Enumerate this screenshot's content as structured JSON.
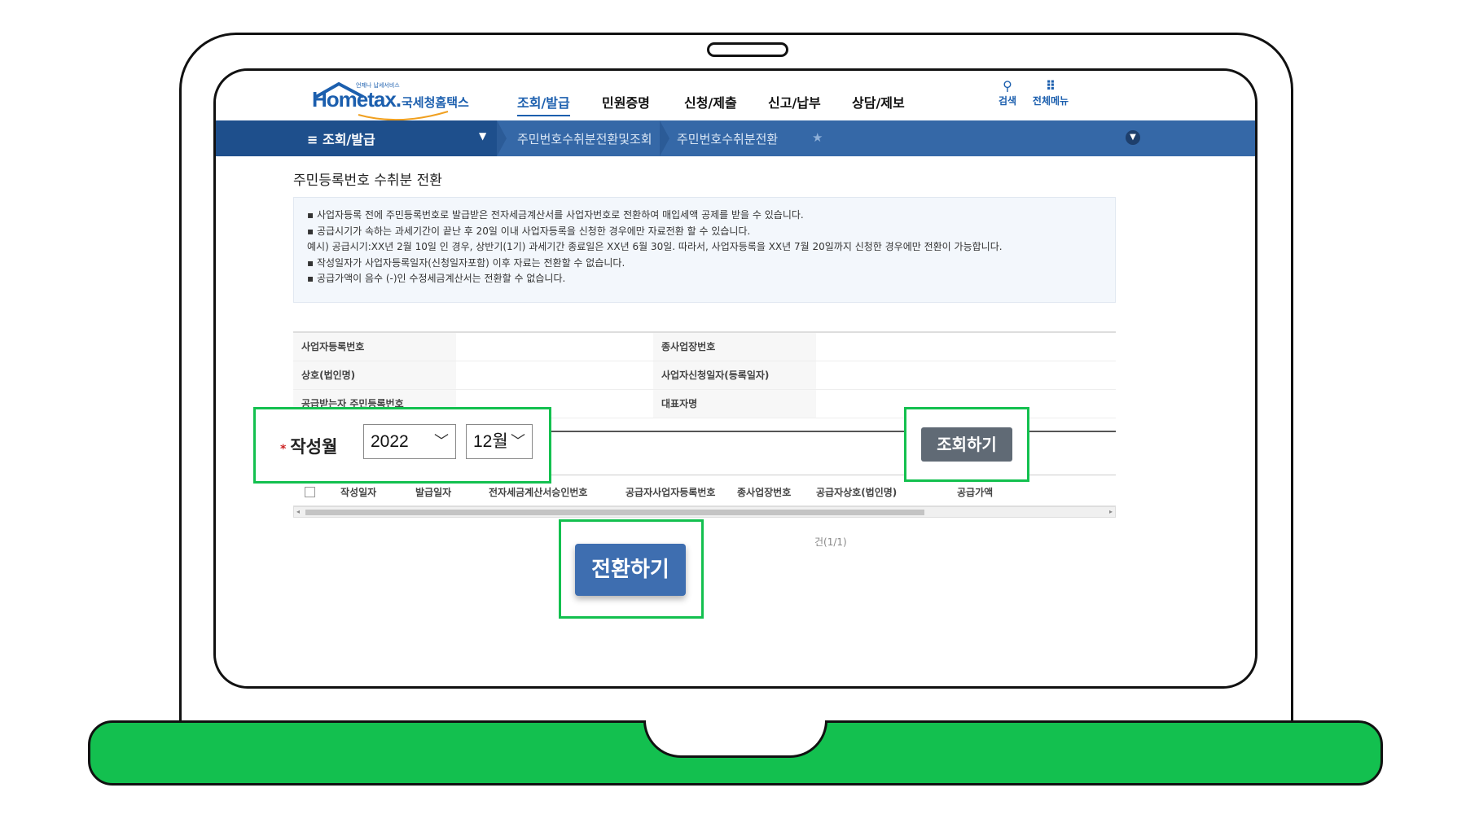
{
  "header": {
    "logo_word": "Hometax.",
    "logo_tiny": "언제나 납세서비스",
    "logo_sub": "국세청홈택스",
    "nav": [
      "조회/발급",
      "민원증명",
      "신청/제출",
      "신고/납부",
      "상담/제보"
    ],
    "tools": {
      "search_label": "검색",
      "menu_label": "전체메뉴"
    }
  },
  "breadcrumb_bar": {
    "menu_label": "조회/발급",
    "crumb1": "주민번호수취분전환및조회",
    "crumb2": "주민번호수취분전환"
  },
  "page": {
    "title": "주민등록번호 수취분 전환",
    "notices": [
      "▪ 사업자등록 전에 주민등록번호로 발급받은 전자세금계산서를 사업자번호로 전환하여 매입세액 공제를 받을 수 있습니다.",
      "▪ 공급시기가 속하는 과세기간이 끝난 후 20일 이내 사업자등록을 신청한 경우에만 자료전환 할 수 있습니다.",
      "   예시) 공급시기:XX년 2월 10일 인 경우, 상반기(1기) 과세기간 종료일은 XX년 6월 30일. 따라서, 사업자등록을 XX년 7월 20일까지 신청한 경우에만 전환이 가능합니다.",
      "▪ 작성일자가 사업자등록일자(신청일자포함) 이후 자료는 전환할 수 없습니다.",
      "▪ 공급가액이 음수 (-)인 수정세금계산서는 전환할 수 없습니다."
    ],
    "info_labels": {
      "biz_no": "사업자등록번호",
      "sub_biz_no": "종사업장번호",
      "company": "상호(법인명)",
      "apply_date": "사업자신청일자(등록일자)",
      "resident_no": "공급받는자 주민등록번호",
      "rep_name": "대표자명"
    },
    "search": {
      "required_mark": "*",
      "label": "작성월",
      "year": "2022",
      "month": "12월",
      "query_button": "조회하기"
    },
    "grid_columns": [
      "작성일자",
      "발급일자",
      "전자세금계산서승인번호",
      "공급자사업자등록번호",
      "종사업장번호",
      "공급자상호(법인명)",
      "공급가액"
    ],
    "page_count": "건(1/1)",
    "convert_button": "전환하기"
  },
  "colors": {
    "accent_green": "#13c04f",
    "nav_blue": "#3568a7",
    "button_blue": "#3e6eb0"
  }
}
